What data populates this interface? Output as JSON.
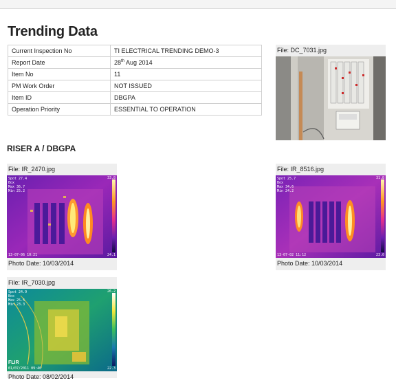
{
  "page": {
    "title": "Trending Data",
    "section_title": "RISER A / DBGPA"
  },
  "info_table": [
    {
      "label": "Current Inspection No",
      "value": "TI ELECTRICAL TRENDING DEMO-3"
    },
    {
      "label": "Report Date",
      "value_day": "28",
      "value_sup": "th",
      "value_rest": " Aug 2014"
    },
    {
      "label": "Item No",
      "value": "11"
    },
    {
      "label": "PM Work Order",
      "value": "NOT ISSUED"
    },
    {
      "label": "Item ID",
      "value": "DBGPA"
    },
    {
      "label": "Operation Priority",
      "value": "ESSENTIAL TO OPERATION"
    }
  ],
  "photo": {
    "file_label": "File: DC_7031.jpg"
  },
  "thermal_images": [
    {
      "file_label": "File: IR_2470.jpg",
      "photo_date": "Photo Date: 10/03/2014",
      "spot": "Spot 27.4",
      "box": "Box",
      "max": "Max 36.7",
      "min": "Min 25.2",
      "scale_top": "33.8",
      "scale_bottom": "24.1",
      "timestamp": "13-07-06 10:21"
    },
    {
      "file_label": "File: IR_8516.jpg",
      "photo_date": "Photo Date: 10/03/2014",
      "spot": "Spot 25.7",
      "box": "Box",
      "max": "Max 34.6",
      "min": "Min 24.2",
      "scale_top": "31.8",
      "scale_bottom": "23.0",
      "timestamp": "13-07-02 11:12"
    },
    {
      "file_label": "File: IR_7030.jpg",
      "photo_date": "Photo Date: 08/02/2014",
      "spot": "Spot 24.9",
      "box": "Box",
      "max": "Max 25.5",
      "min": "Min 23.3",
      "scale_top": "26.2",
      "scale_bottom": "22.3",
      "timestamp": "01/07/2011 09:40",
      "brand": "FLIR"
    }
  ],
  "colors": {
    "caption_bg": "#eeeeee",
    "table_border": "#cfcfcf"
  }
}
